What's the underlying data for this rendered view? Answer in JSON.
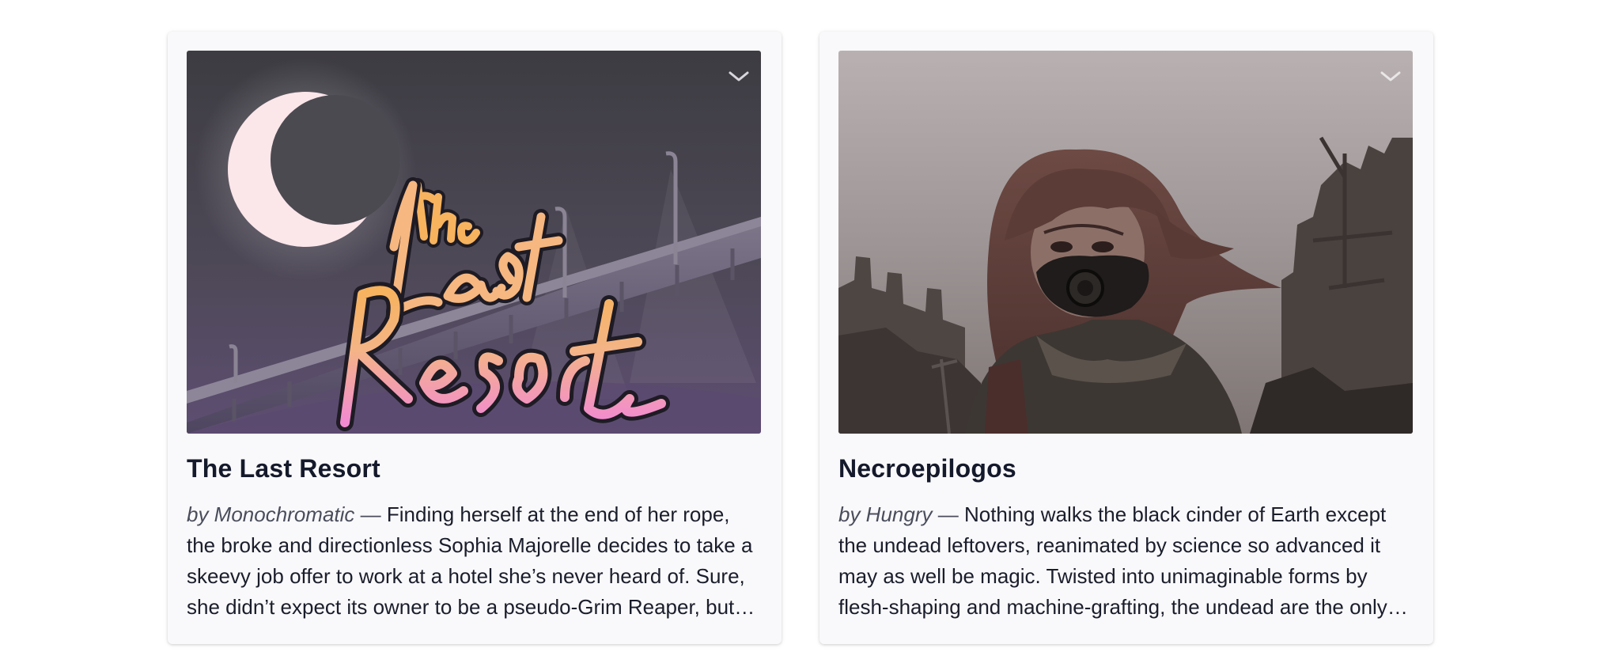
{
  "cards": [
    {
      "title": "The Last Resort",
      "author": "by Monochromatic",
      "separator": "—",
      "description": "Finding herself at the end of her rope, the broke and directionless Sophia Majorelle decides to take a skeevy job offer to work at a hotel she’s never heard of. Sure, she didn’t expect its owner to be a pseudo-Grim Reaper, but it’s a job, isn’t it?",
      "cover_icon": "chevron-down-icon",
      "logo_text": [
        "the",
        "Last",
        "Resort"
      ]
    },
    {
      "title": "Necroepilogos",
      "author": "by Hungry",
      "separator": "—",
      "description": "Nothing walks the black cinder of Earth except the undead leftovers, reanimated by science so advanced it may as well be magic. Twisted into unimaginable forms by flesh-shaping and machine-grafting, the undead are the only things left.",
      "cover_icon": "chevron-down-icon"
    }
  ],
  "colors": {
    "card_background": "#f9f9fb",
    "title": "#14192b",
    "text": "#1a1d2b",
    "author": "#4a4d5c"
  }
}
